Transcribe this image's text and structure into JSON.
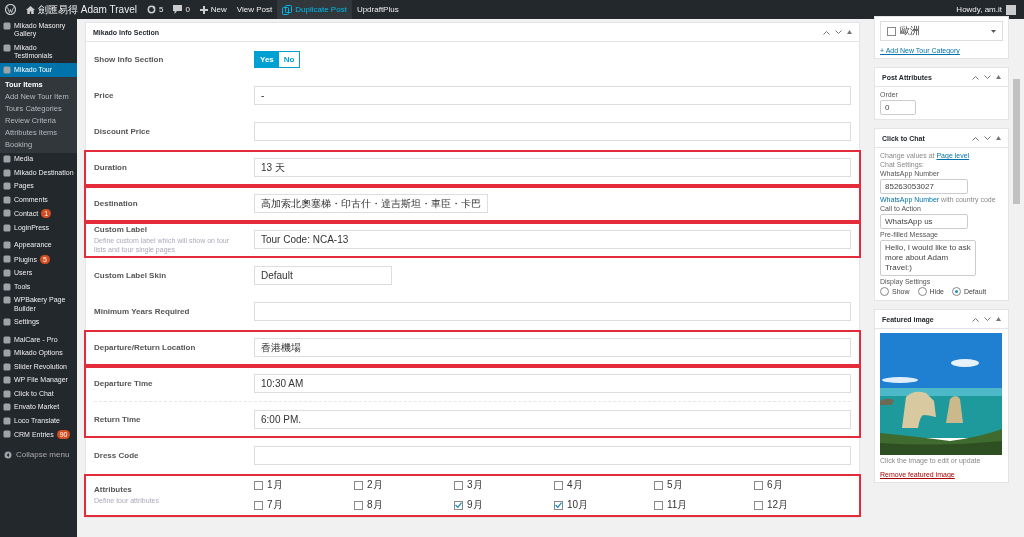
{
  "admin_bar": {
    "items": [
      {
        "kind": "logo",
        "hovered": false
      },
      {
        "kind": "site",
        "label": "劍匯易得 Adam Travel",
        "hovered": false
      },
      {
        "kind": "updates",
        "label": "5",
        "hovered": false
      },
      {
        "kind": "comments",
        "label": "0",
        "hovered": false
      },
      {
        "kind": "new",
        "label": "New",
        "hovered": false
      },
      {
        "kind": "link",
        "label": "View Post",
        "hovered": false
      },
      {
        "kind": "duplicate",
        "label": "Duplicate Post",
        "hovered": true
      },
      {
        "kind": "link",
        "label": "UpdraftPlus",
        "hovered": false
      }
    ],
    "greeting": "Howdy, am.it"
  },
  "sidebar": {
    "sections": [
      {
        "items": [
          {
            "label": "Mikado Masonry Gallery",
            "selected": false
          },
          {
            "label": "Mikado Testimonials",
            "selected": false
          },
          {
            "label": "Mikado Tour",
            "selected": true,
            "children": [
              {
                "label": "Tour Items",
                "selected": true
              },
              {
                "label": "Add New Tour Item",
                "selected": false
              },
              {
                "label": "Tours Categories",
                "selected": false
              },
              {
                "label": "Review Criteria",
                "selected": false
              },
              {
                "label": "Attributes Items",
                "selected": false
              },
              {
                "label": "Booking",
                "selected": false
              }
            ]
          },
          {
            "label": "Media",
            "selected": false
          },
          {
            "label": "Mikado Destination",
            "selected": false
          },
          {
            "label": "Pages",
            "selected": false
          },
          {
            "label": "Comments",
            "selected": false
          },
          {
            "label": "Contact",
            "selected": false,
            "badge": "1"
          },
          {
            "label": "LoginPress",
            "selected": false
          }
        ]
      },
      {
        "items": [
          {
            "label": "Appearance",
            "selected": false
          },
          {
            "label": "Plugins",
            "selected": false,
            "badge": "5"
          },
          {
            "label": "Users",
            "selected": false
          },
          {
            "label": "Tools",
            "selected": false
          },
          {
            "label": "WPBakery Page Builder",
            "selected": false
          },
          {
            "label": "Settings",
            "selected": false
          }
        ]
      },
      {
        "items": [
          {
            "label": "MalCare - Pro",
            "selected": false
          },
          {
            "label": "Mikado Options",
            "selected": false
          },
          {
            "label": "Slider Revolution",
            "selected": false
          },
          {
            "label": "WP File Manager",
            "selected": false
          },
          {
            "label": "Click to Chat",
            "selected": false
          },
          {
            "label": "Envato Market",
            "selected": false
          },
          {
            "label": "Loco Translate",
            "selected": false
          },
          {
            "label": "CRM Entries",
            "selected": false,
            "badge": "90"
          }
        ]
      }
    ],
    "collapse_label": "Collapse menu"
  },
  "info_section": {
    "title": "Mikado Info Section",
    "groups": [
      {
        "highlighted": false,
        "fields": [
          {
            "kind": "toggle",
            "label": "Show Info Section",
            "options": [
              {
                "label": "Yes",
                "selected": true
              },
              {
                "label": "No",
                "selected": false
              }
            ]
          }
        ]
      },
      {
        "highlighted": false,
        "fields": [
          {
            "kind": "text",
            "label": "Price",
            "value": "-"
          }
        ]
      },
      {
        "highlighted": false,
        "fields": [
          {
            "kind": "text",
            "label": "Discount Price"
          }
        ]
      },
      {
        "highlighted": true,
        "fields": [
          {
            "kind": "text",
            "label": "Duration",
            "value": "13 天"
          }
        ]
      },
      {
        "highlighted": true,
        "fields": [
          {
            "kind": "short-text",
            "label": "Destination",
            "value": "高加索北奧塞梯・印古什・達吉斯坦・車臣・卡巴"
          }
        ]
      },
      {
        "highlighted": true,
        "fields": [
          {
            "kind": "text",
            "label": "Custom Label",
            "description": "Define custom label which will show on tour lists and tour single pages",
            "value": "Tour Code: NCA-13"
          }
        ]
      },
      {
        "highlighted": false,
        "fields": [
          {
            "kind": "short-text",
            "label": "Custom Label Skin",
            "value": "Default"
          }
        ]
      },
      {
        "highlighted": false,
        "fields": [
          {
            "kind": "text",
            "label": "Minimum Years Required"
          }
        ]
      },
      {
        "highlighted": true,
        "fields": [
          {
            "kind": "text",
            "label": "Departure/Return Location",
            "value": "香港機場"
          }
        ]
      },
      {
        "highlighted": true,
        "fields": [
          {
            "kind": "text",
            "label": "Departure Time",
            "value": "10:30 AM"
          },
          {
            "kind": "text",
            "label": "Return Time",
            "value": "6:00 PM."
          }
        ]
      },
      {
        "highlighted": false,
        "fields": [
          {
            "kind": "text",
            "label": "Dress Code"
          }
        ]
      },
      {
        "highlighted": true,
        "fields": [
          {
            "kind": "checkboxes",
            "label": "Attributes",
            "description": "Define tour attributes",
            "options": [
              {
                "label": "1月",
                "checked": false
              },
              {
                "label": "2月",
                "checked": false
              },
              {
                "label": "3月",
                "checked": false
              },
              {
                "label": "4月",
                "checked": false
              },
              {
                "label": "5月",
                "checked": false
              },
              {
                "label": "6月",
                "checked": false
              },
              {
                "label": "7月",
                "checked": false
              },
              {
                "label": "8月",
                "checked": false
              },
              {
                "label": "9月",
                "checked": true
              },
              {
                "label": "10月",
                "checked": true
              },
              {
                "label": "11月",
                "checked": false
              },
              {
                "label": "12月",
                "checked": false
              }
            ]
          }
        ]
      }
    ]
  },
  "categories_box": {
    "categories": [
      {
        "label": "歐洲",
        "checked": false
      }
    ],
    "add_link": "+ Add New Tour Category"
  },
  "post_attributes": {
    "title": "Post Attributes",
    "order_label": "Order",
    "order_value": "0"
  },
  "click_to_chat": {
    "title": "Click to Chat",
    "change_text": "Change values at",
    "change_link": "Page level",
    "chat_settings": "Chat Settings:",
    "number_label": "WhatsApp Number",
    "number_value": "85263053027",
    "number_hint_link": "WhatsApp Number",
    "number_hint": "with country code",
    "cta_label": "Call to Action",
    "cta_value": "WhatsApp us",
    "message_label": "Pre-filled Message",
    "message_value": "Hello, I would like to ask more about Adam Travel:)",
    "display_label": "Display Settings",
    "display_options": [
      {
        "label": "Show",
        "selected": false
      },
      {
        "label": "Hide",
        "selected": false
      },
      {
        "label": "Default",
        "selected": true
      }
    ]
  },
  "featured_image": {
    "title": "Featured image",
    "hint": "Click the image to edit or update",
    "remove_link": "Remove featured image"
  }
}
